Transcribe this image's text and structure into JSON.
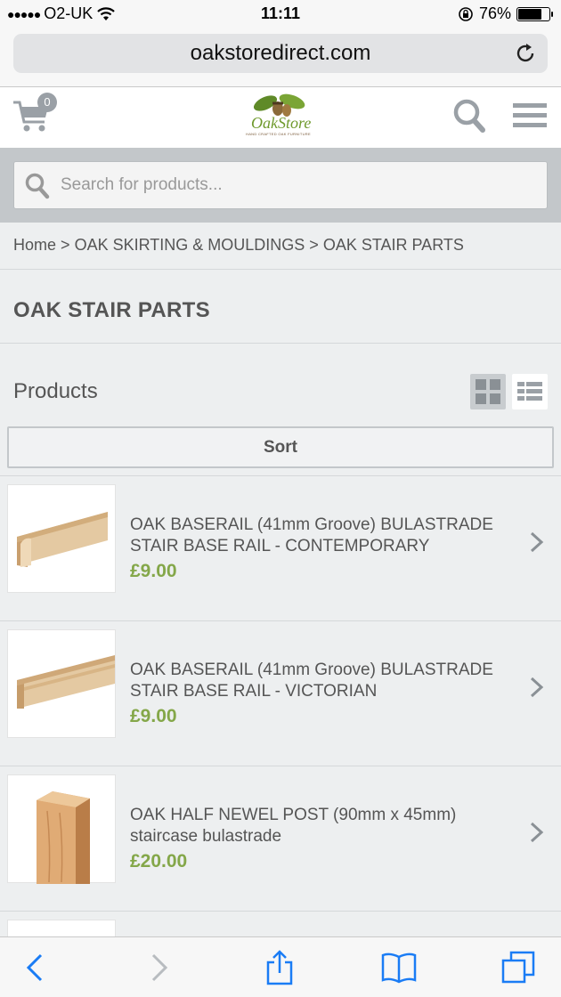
{
  "status_bar": {
    "carrier": "O2-UK",
    "time": "11:11",
    "battery": "76%",
    "battery_level": 0.76
  },
  "browser": {
    "url": "oakstoredirect.com"
  },
  "header": {
    "cart_count": "0",
    "logo_text": "OakStore",
    "logo_tagline": "HAND CRAFTED OAK FURNITURE"
  },
  "search": {
    "placeholder": "Search for products..."
  },
  "breadcrumb": {
    "home": "Home",
    "sep": ">",
    "level1": "OAK SKIRTING & MOULDINGS",
    "level2": "OAK STAIR PARTS"
  },
  "page_title": "OAK STAIR PARTS",
  "products_label": "Products",
  "sort_label": "Sort",
  "products": [
    {
      "name": "OAK BASERAIL (41mm Groove) BULASTRADE STAIR BASE RAIL - CONTEMPORARY",
      "price": "£9.00"
    },
    {
      "name": "OAK BASERAIL (41mm Groove) BULASTRADE STAIR BASE RAIL - VICTORIAN",
      "price": "£9.00"
    },
    {
      "name": "OAK HALF NEWEL POST (90mm x 45mm) staircase bulastrade",
      "price": "£20.00"
    }
  ],
  "colors": {
    "price": "#84a749",
    "background": "#edeff0",
    "search_band": "#c3c7ca"
  }
}
